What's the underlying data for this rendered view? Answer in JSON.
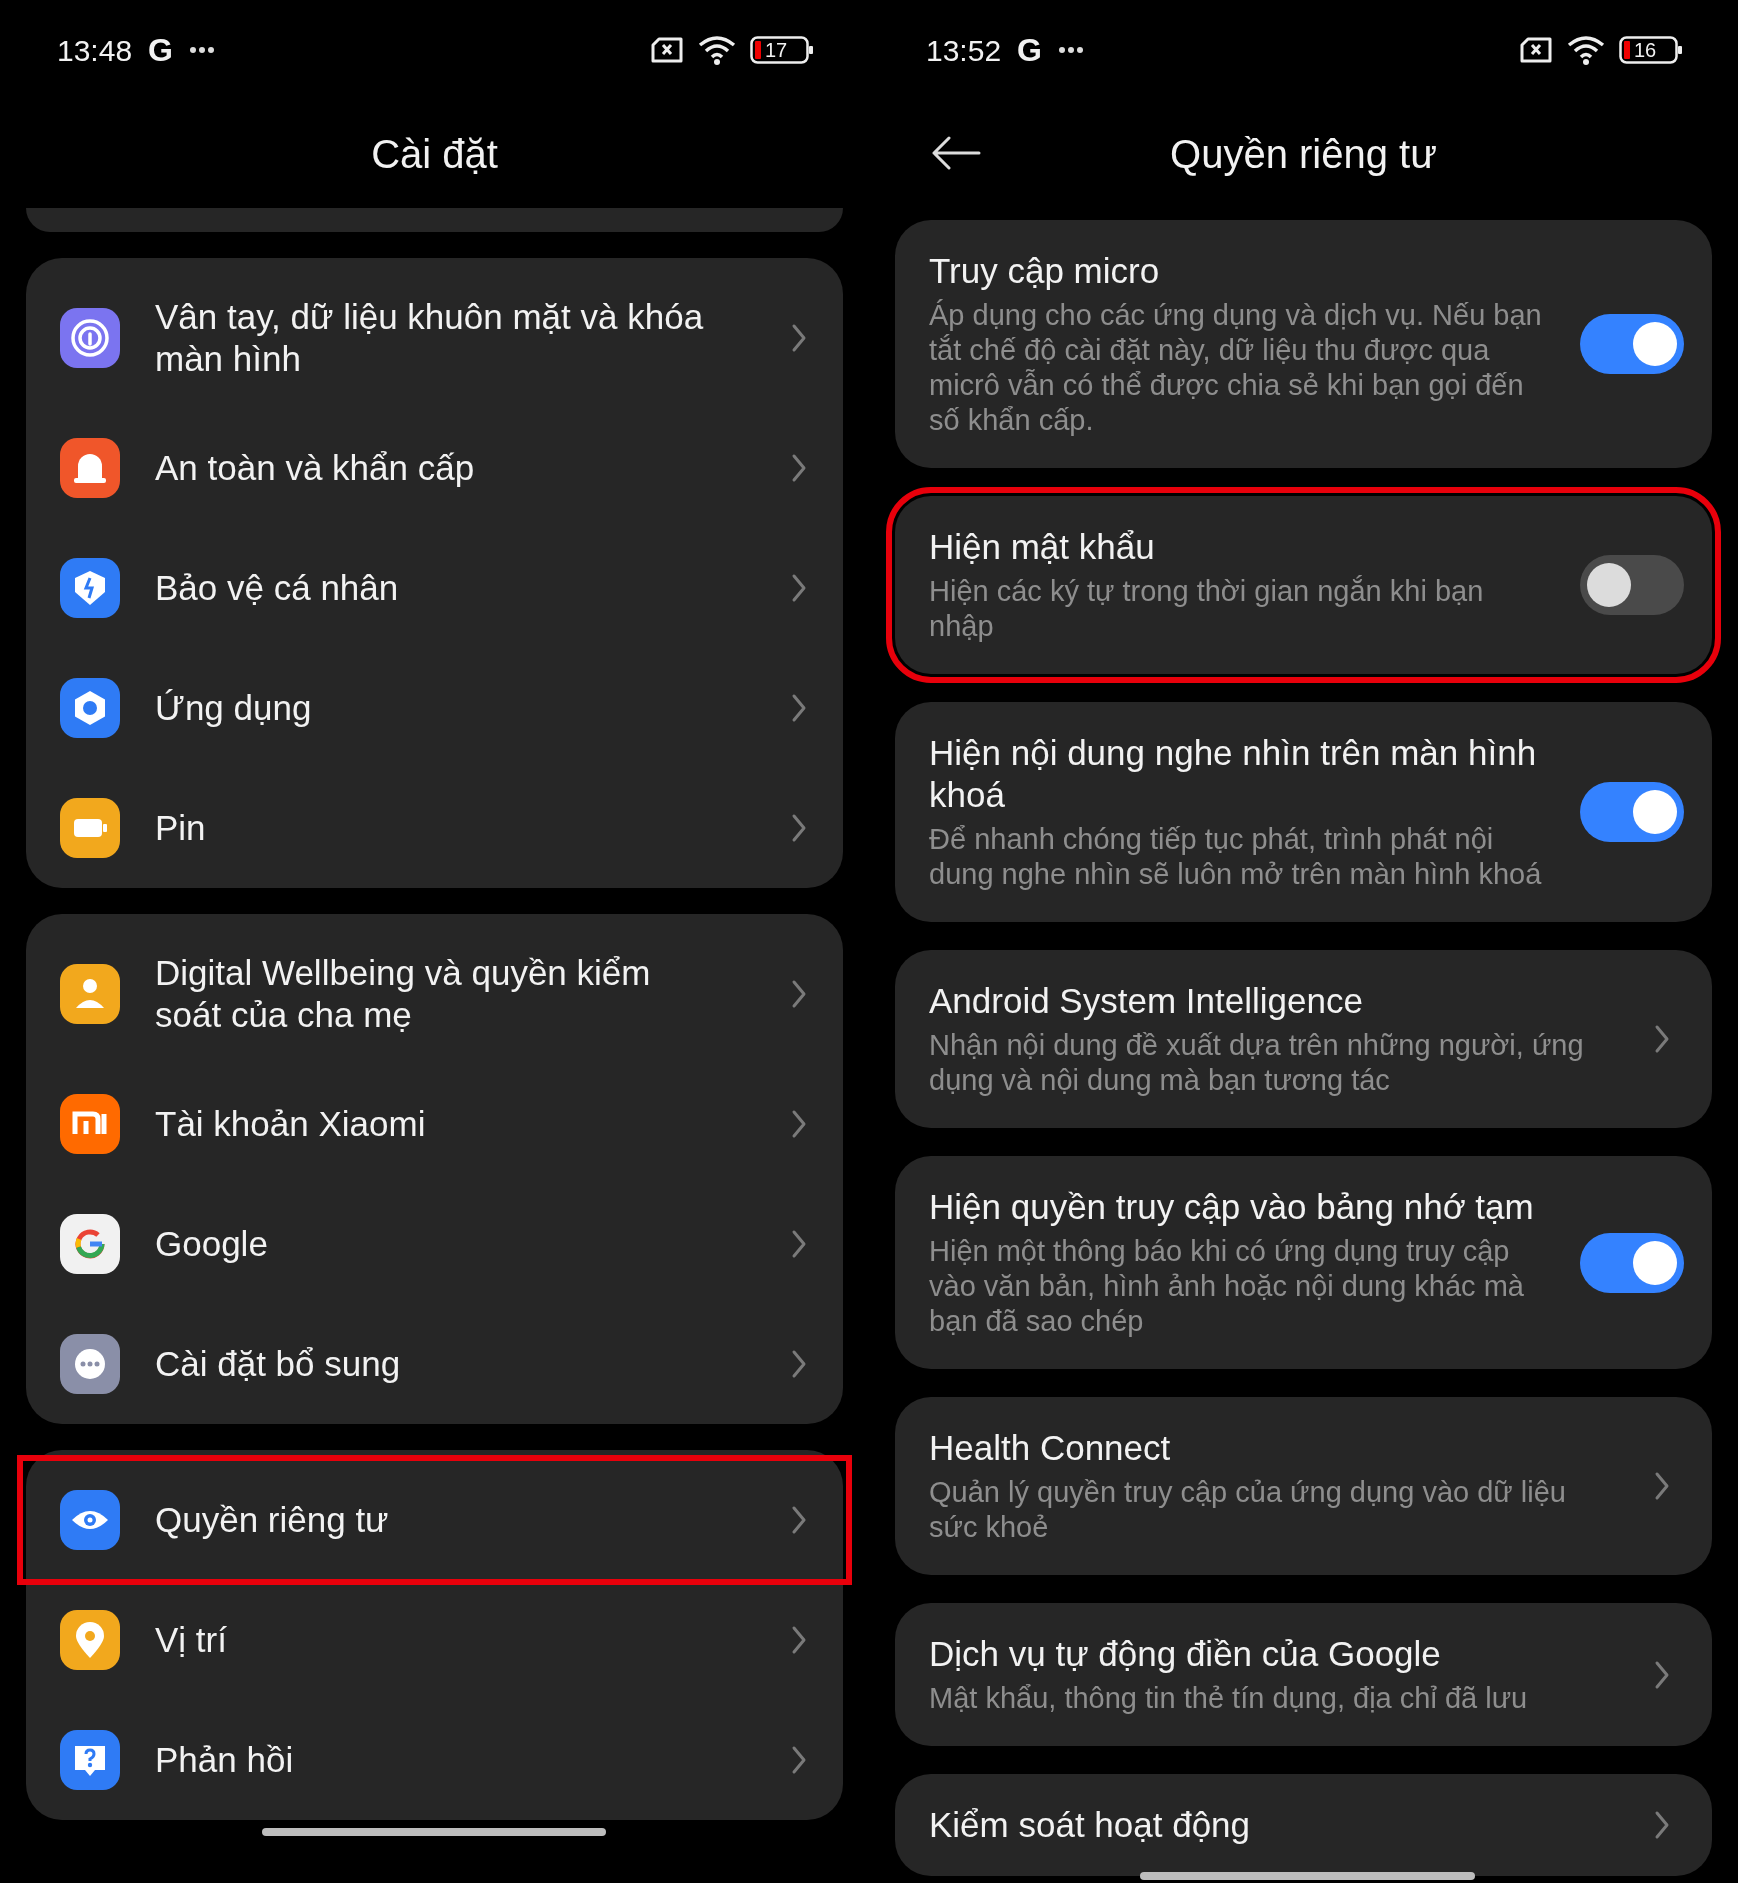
{
  "left_screen": {
    "status_bar": {
      "time": "13:48",
      "notification": "G",
      "battery": "17"
    },
    "title": "Cài đặt",
    "groups": [
      {
        "items": [
          {
            "label": "Vân tay, dữ liệu khuôn mặt và khóa màn hình",
            "highlighted": false
          },
          {
            "label": "An toàn và khẩn cấp",
            "highlighted": false
          },
          {
            "label": "Bảo vệ cá nhân",
            "highlighted": false
          },
          {
            "label": "Ứng dụng",
            "highlighted": false
          },
          {
            "label": "Pin",
            "highlighted": false
          }
        ]
      },
      {
        "items": [
          {
            "label": "Digital Wellbeing và quyền kiểm soát của cha mẹ",
            "highlighted": false
          },
          {
            "label": "Tài khoản Xiaomi",
            "highlighted": false
          },
          {
            "label": "Google",
            "highlighted": false
          },
          {
            "label": "Cài đặt bổ sung",
            "highlighted": false
          }
        ]
      },
      {
        "items": [
          {
            "label": "Quyền riêng tư",
            "highlighted": true
          },
          {
            "label": "Vị trí",
            "highlighted": false
          },
          {
            "label": "Phản hồi",
            "highlighted": false
          }
        ]
      }
    ]
  },
  "right_screen": {
    "status_bar": {
      "time": "13:52",
      "notification": "G",
      "battery": "16"
    },
    "title": "Quyền riêng tư",
    "cards": [
      {
        "kind": "toggle",
        "title": "Truy cập micro",
        "subtitle": "Áp dụng cho các ứng dụng và dịch vụ. Nếu bạn tắt chế độ cài đặt này, dữ liệu thu được qua micrô vẫn có thể được chia sẻ khi bạn gọi đến số khẩn cấp.",
        "on": true,
        "highlighted": false
      },
      {
        "kind": "toggle",
        "title": "Hiện mật khẩu",
        "subtitle": "Hiện các ký tự trong thời gian ngắn khi bạn nhập",
        "on": false,
        "highlighted": true
      },
      {
        "kind": "toggle",
        "title": "Hiện nội dung nghe nhìn trên màn hình khoá",
        "subtitle": "Để nhanh chóng tiếp tục phát, trình phát nội dung nghe nhìn sẽ luôn mở trên màn hình khoá",
        "on": true,
        "highlighted": false
      },
      {
        "kind": "link",
        "title": "Android System Intelligence",
        "subtitle": "Nhận nội dung đề xuất dựa trên những người, ứng dụng và nội dung mà bạn tương tác",
        "highlighted": false
      },
      {
        "kind": "toggle",
        "title": "Hiện quyền truy cập vào bảng nhớ tạm",
        "subtitle": "Hiện một thông báo khi có ứng dụng truy cập vào văn bản, hình ảnh hoặc nội dung khác mà bạn đã sao chép",
        "on": true,
        "highlighted": false
      },
      {
        "kind": "link",
        "title": "Health Connect",
        "subtitle": "Quản lý quyền truy cập của ứng dụng vào dữ liệu sức khoẻ",
        "highlighted": false
      },
      {
        "kind": "link",
        "title": "Dịch vụ tự động điền của Google",
        "subtitle": "Mật khẩu, thông tin thẻ tín dụng, địa chỉ đã lưu",
        "highlighted": false
      },
      {
        "kind": "link",
        "title": "Kiểm soát hoạt động",
        "highlighted": false
      }
    ]
  }
}
